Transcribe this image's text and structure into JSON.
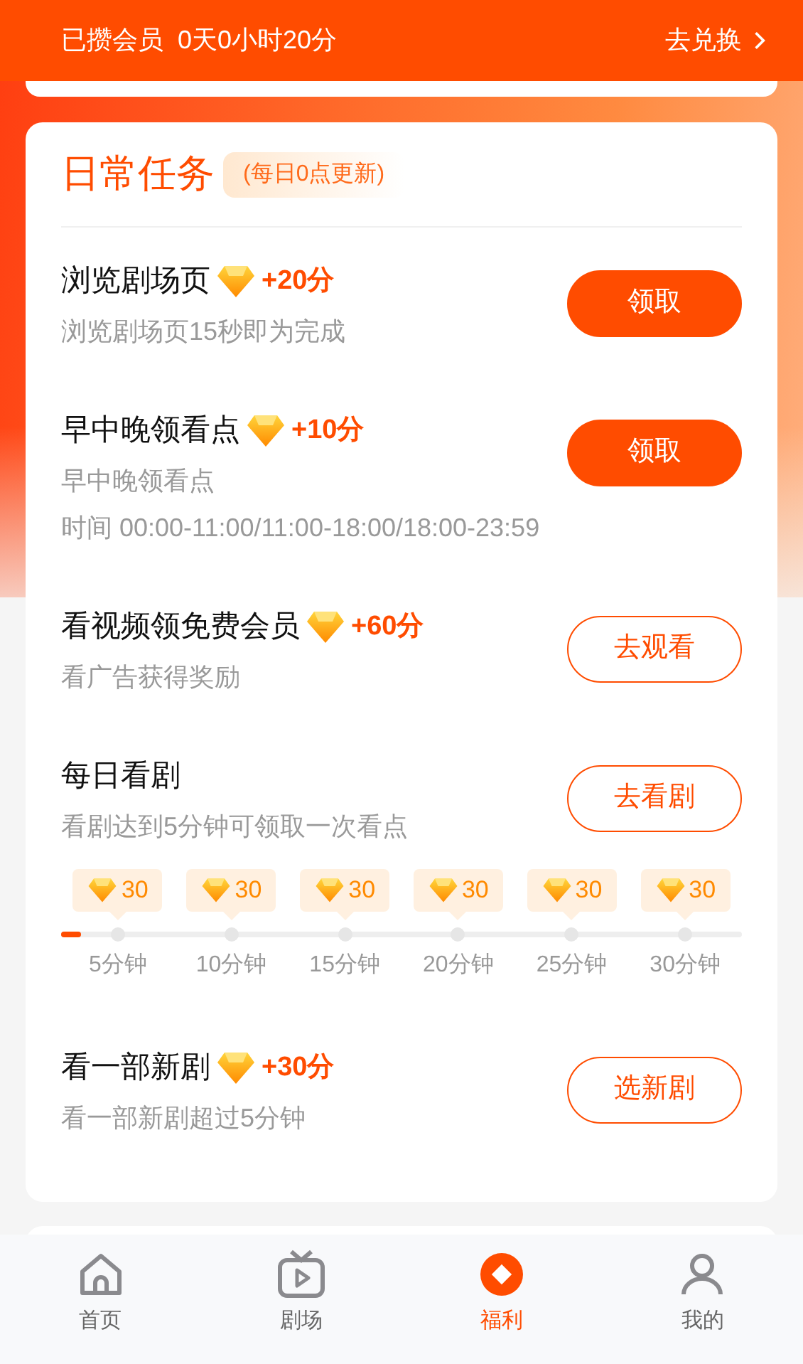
{
  "top_bar": {
    "label": "已攒会员",
    "value": "0天0小时20分",
    "action": "去兑换"
  },
  "daily_tasks": {
    "title": "日常任务",
    "note": "(每日0点更新)",
    "tasks": [
      {
        "title": "浏览剧场页",
        "reward": "+20分",
        "details": [
          "浏览剧场页15秒即为完成"
        ],
        "button": {
          "label": "领取",
          "kind": "filled"
        }
      },
      {
        "title": "早中晚领看点",
        "reward": "+10分",
        "details": [
          "早中晚领看点",
          "时间 00:00-11:00/11:00-18:00/18:00-23:59"
        ],
        "button": {
          "label": "领取",
          "kind": "filled"
        }
      },
      {
        "title": "看视频领免费会员",
        "reward": "+60分",
        "details": [
          "看广告获得奖励"
        ],
        "button": {
          "label": "去观看",
          "kind": "outline"
        }
      },
      {
        "title": "每日看剧",
        "details": [
          "看剧达到5分钟可领取一次看点"
        ],
        "button": {
          "label": "去看剧",
          "kind": "outline"
        },
        "progress": {
          "level": 0.03,
          "steps": [
            {
              "reward": "30",
              "time": "5分钟"
            },
            {
              "reward": "30",
              "time": "10分钟"
            },
            {
              "reward": "30",
              "time": "15分钟"
            },
            {
              "reward": "30",
              "time": "20分钟"
            },
            {
              "reward": "30",
              "time": "25分钟"
            },
            {
              "reward": "30",
              "time": "30分钟"
            }
          ]
        }
      },
      {
        "title": "看一部新剧",
        "reward": "+30分",
        "details": [
          "看一部新剧超过5分钟"
        ],
        "button": {
          "label": "选新剧",
          "kind": "outline"
        }
      }
    ]
  },
  "bottom_nav": [
    {
      "label": "首页",
      "kind": "home",
      "selected": false
    },
    {
      "label": "剧场",
      "kind": "tv",
      "selected": false
    },
    {
      "label": "福利",
      "kind": "coin",
      "selected": true
    },
    {
      "label": "我的",
      "kind": "user",
      "selected": false
    }
  ]
}
